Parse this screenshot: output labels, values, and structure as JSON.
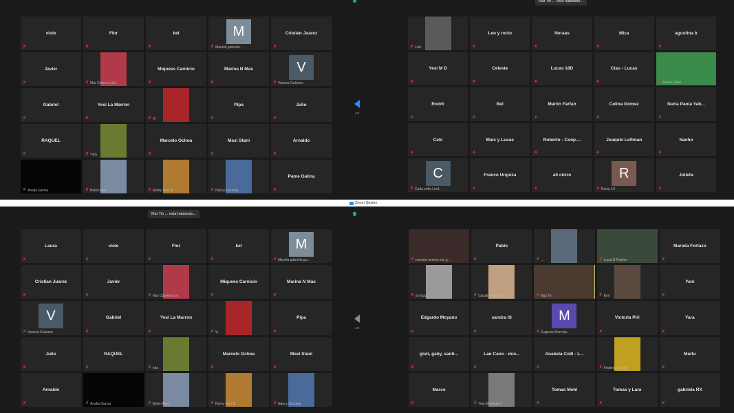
{
  "colors": {
    "accent": "#2d8cff",
    "shield": "#23b14d",
    "muted_mic": "#d33333",
    "active_speaker": "#c9c96a"
  },
  "toasts": {
    "q2": "Mar Tin ... esta hablando...",
    "q3": "Mar Tin ... esta hablando..."
  },
  "zoom_label": "Zoom Sesion",
  "pagination": {
    "q1": "1/4",
    "q3": "1/4"
  },
  "quadrants": [
    {
      "tiles": [
        {
          "name": "viole"
        },
        {
          "name": "Flor"
        },
        {
          "name": "kel"
        },
        {
          "avatar": "M",
          "avatar_color": "#7c8c98",
          "caption": "Mariela gabriela ..."
        },
        {
          "name": "Cristian Juarez"
        },
        {
          "name": "Javier"
        },
        {
          "video": "#b03a4a",
          "caption": "Mar Cabrera Lini..."
        },
        {
          "name": "Miquees Carnicio"
        },
        {
          "name": "Marina N Mas"
        },
        {
          "avatar": "V",
          "avatar_color": "#4a5a66",
          "caption": "Vanesa Galeano"
        },
        {
          "name": "Gabriel"
        },
        {
          "name": "Yesi La Marron"
        },
        {
          "video": "#a8262a",
          "caption": "Vi"
        },
        {
          "name": "Pipa"
        },
        {
          "name": "Julio"
        },
        {
          "name": "RAQUEL"
        },
        {
          "video": "#6a7a30",
          "caption": "YES"
        },
        {
          "name": "Marcelo Ochoa"
        },
        {
          "name": "Maxi Stani"
        },
        {
          "name": "Arnaldo"
        },
        {
          "video": "#050505",
          "caption": "Analia Garcia"
        },
        {
          "video": "#7a8aa0",
          "caption": "Belen Mas"
        },
        {
          "video": "#b07a30",
          "caption": "Romy Ruiz B"
        },
        {
          "video": "#4a6a9a",
          "caption": "Nancy Escobar"
        },
        {
          "name": "Pame Galina"
        }
      ]
    },
    {
      "tiles": [
        {
          "video": "#5a5a5a",
          "caption": "Lolo"
        },
        {
          "name": "Leo y rocio"
        },
        {
          "name": "Neraas"
        },
        {
          "name": "Mica"
        },
        {
          "name": "agustina b"
        },
        {
          "name": "Yesi M D"
        },
        {
          "name": "Celeste"
        },
        {
          "name": "Lucas 18D"
        },
        {
          "name": "Clau - Lucas"
        },
        {
          "video": "#3a8a4a",
          "caption": "Paula Gabe"
        },
        {
          "name": "Rodril"
        },
        {
          "name": "Bel"
        },
        {
          "name": "Martin Farfan"
        },
        {
          "name": "Celina Gomez"
        },
        {
          "name": "Nuria Paola Yab..."
        },
        {
          "name": "Ceki"
        },
        {
          "name": "Malc y Lucas"
        },
        {
          "name": "Roberto - Coop...."
        },
        {
          "name": "Joaquin Lofiman"
        },
        {
          "name": "Nacho"
        },
        {
          "avatar": "C",
          "avatar_color": "#4a5a66",
          "caption": "Carla sofia Lind..."
        },
        {
          "name": "Franco Urquiza"
        },
        {
          "name": "ali ciciro"
        },
        {
          "avatar": "R",
          "avatar_color": "#7a5a50",
          "caption": "Rocio LO"
        },
        {
          "name": "Julieta"
        }
      ]
    },
    {
      "tiles": [
        {
          "name": "Laura"
        },
        {
          "name": "viole"
        },
        {
          "name": "Flor"
        },
        {
          "name": "kel"
        },
        {
          "avatar": "M",
          "avatar_color": "#7c8c98",
          "caption": "Mariela gabriela gu..."
        },
        {
          "name": "Cristian Juarez"
        },
        {
          "name": "Javier"
        },
        {
          "video": "#b03a4a",
          "caption": "Mar Cabrera Lini"
        },
        {
          "name": "Miquees Carnicio"
        },
        {
          "name": "Marina N Mas"
        },
        {
          "avatar": "V",
          "avatar_color": "#4a5a66",
          "caption": "Vanesa Galeano"
        },
        {
          "name": "Gabriel"
        },
        {
          "name": "Yesi La Marron"
        },
        {
          "video": "#a8262a",
          "caption": "Vi"
        },
        {
          "name": "Pipa"
        },
        {
          "name": "Julio"
        },
        {
          "name": "RAQUEL"
        },
        {
          "video": "#6a7a30",
          "caption": "Iola"
        },
        {
          "name": "Marcelo Ochoa"
        },
        {
          "name": "Maxi Stani"
        },
        {
          "name": "Arnaldo"
        },
        {
          "video": "#050505",
          "caption": "Analia Garcia"
        },
        {
          "video": "#7a8aa0",
          "caption": "Belen Mas"
        },
        {
          "video": "#b07a30",
          "caption": "Romy Ruiz B"
        },
        {
          "video": "#4a6a9a",
          "caption": "Nancy Escobar"
        }
      ]
    },
    {
      "tiles": [
        {
          "video": "#3a2a2a",
          "caption": "mariela romina ruiz g..."
        },
        {
          "name": "Pablo"
        },
        {
          "video": "#5a6a7a",
          "caption": "..."
        },
        {
          "video": "#3a4a3a",
          "caption": "Lucia D Padron"
        },
        {
          "name": "Mariela Fortazo"
        },
        {
          "video": "#9a9a9a",
          "caption": "ari Igaz"
        },
        {
          "video": "#c0a080",
          "caption": "Claudia noyaxel"
        },
        {
          "video": "#4a3a30",
          "caption": "Mar Tin",
          "highlight": true
        },
        {
          "video": "#5a4a40",
          "caption": "Eon"
        },
        {
          "name": "Yani"
        },
        {
          "name": "Edgardo Moyano"
        },
        {
          "name": "sandra IS"
        },
        {
          "avatar": "M",
          "avatar_color": "#5a4ab0",
          "caption": "Eugenia Marcela..."
        },
        {
          "name": "Victoria Piri"
        },
        {
          "name": "Yara"
        },
        {
          "name": "giuli, gaby, santi..."
        },
        {
          "name": "Lau Cano - dco..."
        },
        {
          "name": "Anabela Colli - L..."
        },
        {
          "video": "#c0a020",
          "caption": "Federico Jilcida"
        },
        {
          "name": "Martu"
        },
        {
          "name": "Marco"
        },
        {
          "video": "#7a7a7a",
          "caption": "Yesi Mosimanni"
        },
        {
          "name": "Tomas Mehl"
        },
        {
          "name": "Tomas y Lara"
        },
        {
          "name": "gabriela RX"
        }
      ]
    }
  ]
}
